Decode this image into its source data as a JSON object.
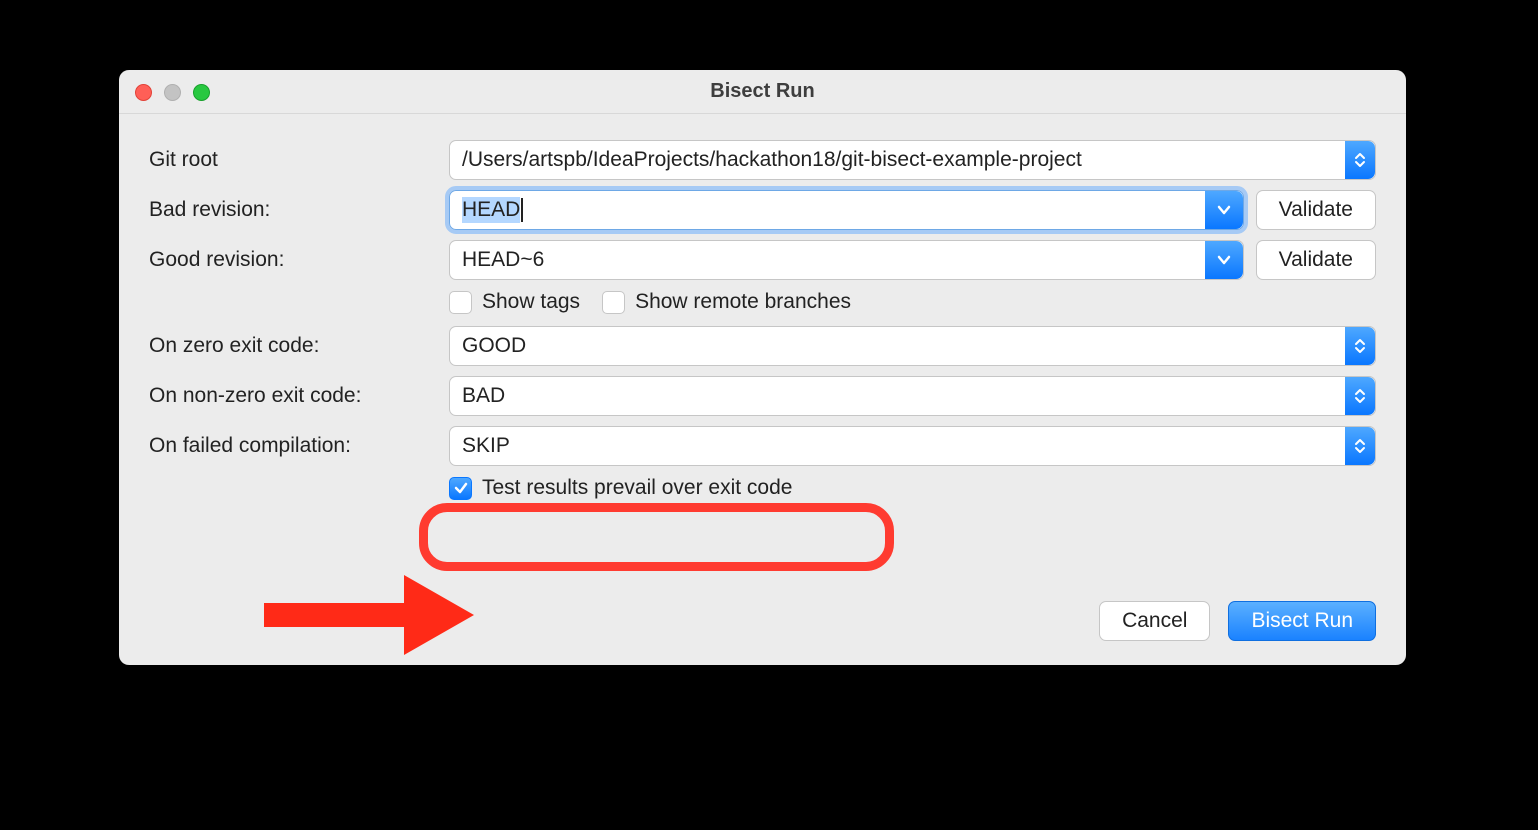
{
  "dialog": {
    "title": "Bisect Run"
  },
  "labels": {
    "git_root": "Git root",
    "bad_revision": "Bad revision:",
    "good_revision": "Good revision:",
    "on_zero": "On zero exit code:",
    "on_nonzero": "On non-zero exit code:",
    "on_failed": "On failed compilation:",
    "show_tags": "Show tags",
    "show_remote": "Show remote branches",
    "test_prevail": "Test results prevail over exit code"
  },
  "values": {
    "git_root": "/Users/artspb/IdeaProjects/hackathon18/git-bisect-example-project",
    "bad_revision": "HEAD",
    "good_revision": "HEAD~6",
    "on_zero": "GOOD",
    "on_nonzero": "BAD",
    "on_failed": "SKIP"
  },
  "buttons": {
    "validate": "Validate",
    "cancel": "Cancel",
    "run": "Bisect Run"
  },
  "checks": {
    "show_tags": false,
    "show_remote": false,
    "test_prevail": true
  }
}
